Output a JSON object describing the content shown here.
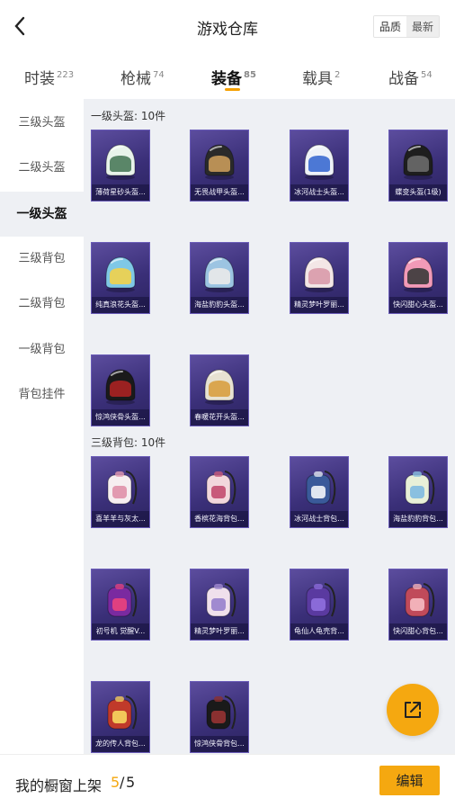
{
  "header": {
    "title": "游戏仓库",
    "back_icon": "chevron-left-icon",
    "sort_options": [
      "品质",
      "最新"
    ]
  },
  "tabs": [
    {
      "label": "时装",
      "count": "223"
    },
    {
      "label": "枪械",
      "count": "74"
    },
    {
      "label": "装备",
      "count": "85",
      "active": true
    },
    {
      "label": "载具",
      "count": "2"
    },
    {
      "label": "战备",
      "count": "54"
    }
  ],
  "sidebar": {
    "items": [
      {
        "label": "三级头盔"
      },
      {
        "label": "二级头盔"
      },
      {
        "label": "一级头盔",
        "active": true
      },
      {
        "label": "三级背包"
      },
      {
        "label": "二级背包"
      },
      {
        "label": "一级背包"
      },
      {
        "label": "背包挂件"
      }
    ]
  },
  "sections": [
    {
      "title": "一级头盔: 10件",
      "items": [
        {
          "name": "薄荷星砂头盔...",
          "art": "helmet",
          "color": "#e8f3ea",
          "accent": "#4a7a5a"
        },
        {
          "name": "无畏战甲头盔...",
          "art": "helmet",
          "color": "#2a2a2a",
          "accent": "#c89a5a"
        },
        {
          "name": "冰河战士头盔...",
          "art": "helmet",
          "color": "#eef2f8",
          "accent": "#3a6ad0"
        },
        {
          "name": "蝶变头盔(1级)",
          "art": "helmet",
          "color": "#1e1e1e",
          "accent": "#6a6a6a"
        },
        {
          "name": "纯真浪花头盔...",
          "art": "helmet",
          "color": "#7fc8e6",
          "accent": "#f2d24a"
        },
        {
          "name": "海盐豹豹头盔...",
          "art": "helmet",
          "color": "#9cc4e2",
          "accent": "#eaeaea"
        },
        {
          "name": "精灵梦叶罗丽...",
          "art": "helmet",
          "color": "#f3e6e6",
          "accent": "#d99aaa"
        },
        {
          "name": "快闪甜心头盔...",
          "art": "helmet",
          "color": "#f29ab8",
          "accent": "#3a3a3a"
        },
        {
          "name": "惊鸿侠骨头盔...",
          "art": "helmet",
          "color": "#1a1a1a",
          "accent": "#aa2222"
        },
        {
          "name": "春暖花开头盔...",
          "art": "helmet",
          "color": "#e7e2d2",
          "accent": "#d8a040"
        }
      ]
    },
    {
      "title": "三级背包: 10件",
      "items": [
        {
          "name": "喜羊羊与灰太...",
          "art": "backpack",
          "color": "#f6eef0",
          "accent": "#e29ab0"
        },
        {
          "name": "香槟花海背包...",
          "art": "backpack",
          "color": "#f2d7dc",
          "accent": "#c85a7a"
        },
        {
          "name": "冰河战士背包...",
          "art": "backpack",
          "color": "#3a5a9a",
          "accent": "#e0e6f0"
        },
        {
          "name": "海盐豹豹背包...",
          "art": "backpack",
          "color": "#e8f0d8",
          "accent": "#8ac0e0"
        },
        {
          "name": "初号机 觉醒V...",
          "art": "backpack",
          "color": "#7a2aa0",
          "accent": "#e04080"
        },
        {
          "name": "精灵梦叶罗丽...",
          "art": "backpack",
          "color": "#f0e0ec",
          "accent": "#a08ad0"
        },
        {
          "name": "龟仙人龟壳背...",
          "art": "backpack",
          "color": "#5a3aa0",
          "accent": "#8a6ad8"
        },
        {
          "name": "快闪甜心背包...",
          "art": "backpack",
          "color": "#c04a5a",
          "accent": "#f2b0b8"
        },
        {
          "name": "龙的传人背包...",
          "art": "backpack",
          "color": "#c03a2a",
          "accent": "#f2c85a"
        },
        {
          "name": "惊鸿侠骨背包...",
          "art": "backpack",
          "color": "#1a1a1a",
          "accent": "#8a3030"
        }
      ]
    }
  ],
  "fab": {
    "icon": "share-external-icon"
  },
  "bottom": {
    "shelf_label": "我的橱窗上架",
    "shelf_current": "5",
    "shelf_separator": "/",
    "shelf_total": "5",
    "edit_label": "编辑"
  },
  "colors": {
    "accent": "#f5a810",
    "content_bg": "#eef0f4",
    "card_bg": "#4a3d8c"
  }
}
